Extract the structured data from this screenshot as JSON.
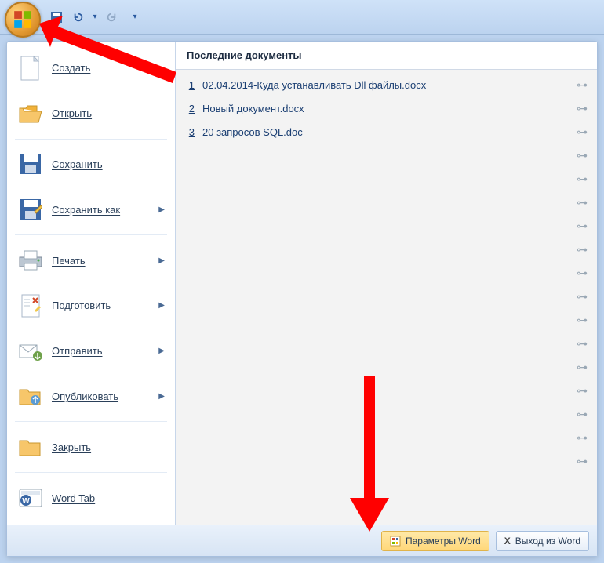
{
  "qat": {
    "save": "save",
    "undo": "undo",
    "redo": "redo"
  },
  "menu": {
    "new": "Создать",
    "open": "Открыть",
    "save": "Сохранить",
    "saveAs": "Сохранить как",
    "print": "Печать",
    "prepare": "Подготовить",
    "send": "Отправить",
    "publish": "Опубликовать",
    "close": "Закрыть",
    "wordTab": "Word Tab"
  },
  "recent": {
    "header": "Последние документы",
    "items": [
      {
        "n": "1",
        "title": "02.04.2014-Куда устанавливать Dll файлы.docx"
      },
      {
        "n": "2",
        "title": "Новый документ.docx"
      },
      {
        "n": "3",
        "title": "20 запросов SQL.doc"
      }
    ]
  },
  "footer": {
    "options": "Параметры Word",
    "exit": "Выход из Word"
  }
}
